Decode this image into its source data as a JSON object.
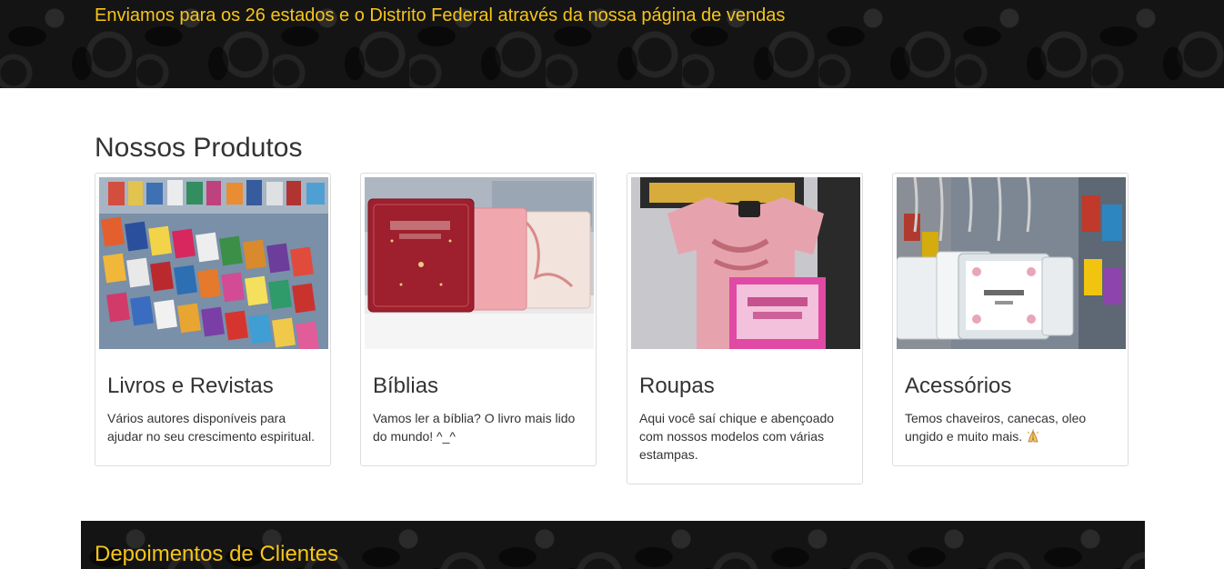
{
  "banner": {
    "text": "Enviamos para os 26 estados e o Distrito Federal através da nossa página de vendas"
  },
  "products": {
    "title": "Nossos Produtos",
    "cards": [
      {
        "title": "Livros e Revistas",
        "text": "Vários autores disponíveis para ajudar no seu crescimento espiritual.",
        "image_icon": "magazine-rack-photo"
      },
      {
        "title": "Bíblias",
        "text": "Vamos ler a bíblia? O livro mais lido do mundo! ^_^",
        "image_icon": "bibles-photo"
      },
      {
        "title": "Roupas",
        "text": "Aqui você saí chique e abençoado com nossos modelos com várias estampas.",
        "image_icon": "tshirt-photo"
      },
      {
        "title": "Acessórios",
        "text": "Temos chaveiros, canecas, oleo ungido e muito mais.",
        "image_icon": "keychains-photo",
        "trailing_icon": "praying-hands-icon"
      }
    ]
  },
  "testimonials": {
    "title": "Depoimentos de Clientes"
  },
  "colors": {
    "accent": "#f6c519",
    "dark_band": "#141414",
    "text": "#333333",
    "card_border": "#dddddd"
  }
}
